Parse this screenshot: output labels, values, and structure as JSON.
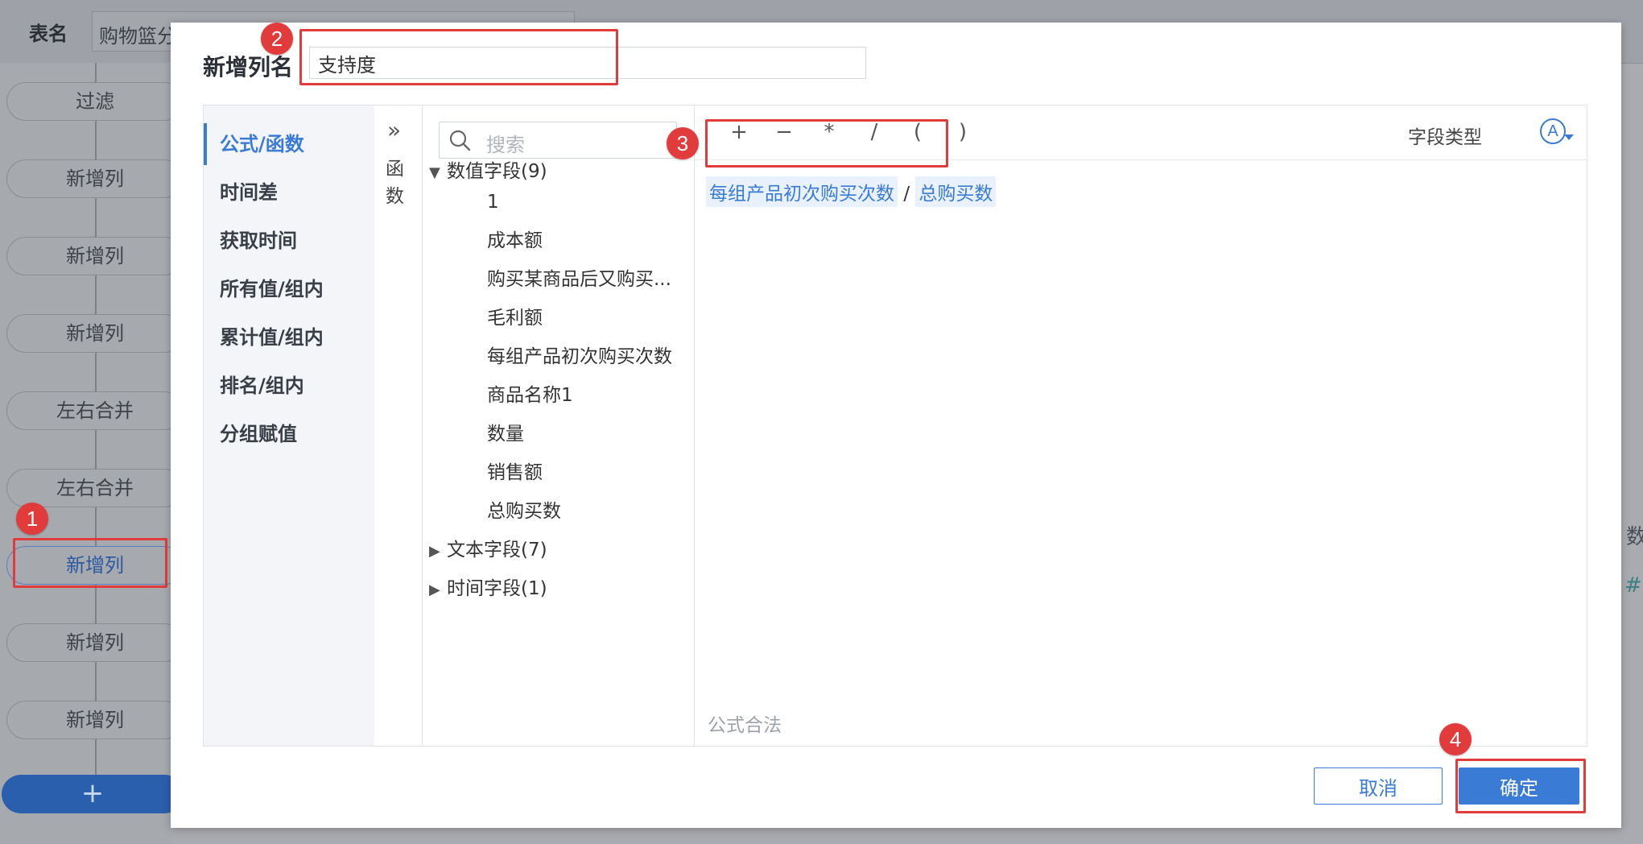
{
  "background": {
    "table_name_label": "表名",
    "table_name_value": "购物篮分",
    "steps": [
      "过滤",
      "新增列",
      "新增列",
      "新增列",
      "左右合并",
      "左右合并",
      "新增列",
      "新增列",
      "新增列"
    ],
    "active_step_index": 6,
    "add_step_label": "+",
    "right_fragments": [
      "数",
      "#"
    ]
  },
  "dialog": {
    "title": "新增列名",
    "column_name_value": "支持度",
    "categories": [
      "公式/函数",
      "时间差",
      "获取时间",
      "所有值/组内",
      "累计值/组内",
      "排名/组内",
      "分组赋值"
    ],
    "active_category_index": 0,
    "collapse": {
      "icon": "double-chevron-right-icon",
      "label": "函数"
    },
    "search": {
      "placeholder": "搜索",
      "icon": "search-icon"
    },
    "field_tree": {
      "numeric_group": "数值字段(9)",
      "numeric_fields": [
        "1",
        "成本额",
        "购买某商品后又购买...",
        "毛利额",
        "每组产品初次购买次数",
        "商品名称1",
        "数量",
        "销售额",
        "总购买数"
      ],
      "text_group": "文本字段(7)",
      "time_group": "时间字段(1)"
    },
    "toolbar": {
      "operators": [
        "+",
        "−",
        "*",
        "/",
        "(",
        ")"
      ],
      "field_type_label": "字段类型",
      "field_type_icon_letter": "A"
    },
    "formula": {
      "token1": "每组产品初次购买次数",
      "operator": "/",
      "token2": "总购买数"
    },
    "formula_status": "公式合法",
    "buttons": {
      "cancel": "取消",
      "ok": "确定"
    }
  },
  "annotations": {
    "badges": [
      "1",
      "2",
      "3",
      "4"
    ],
    "color": "#e13b3b"
  },
  "colors": {
    "accent": "#3a7bd5",
    "highlight": "#e13b3b"
  }
}
